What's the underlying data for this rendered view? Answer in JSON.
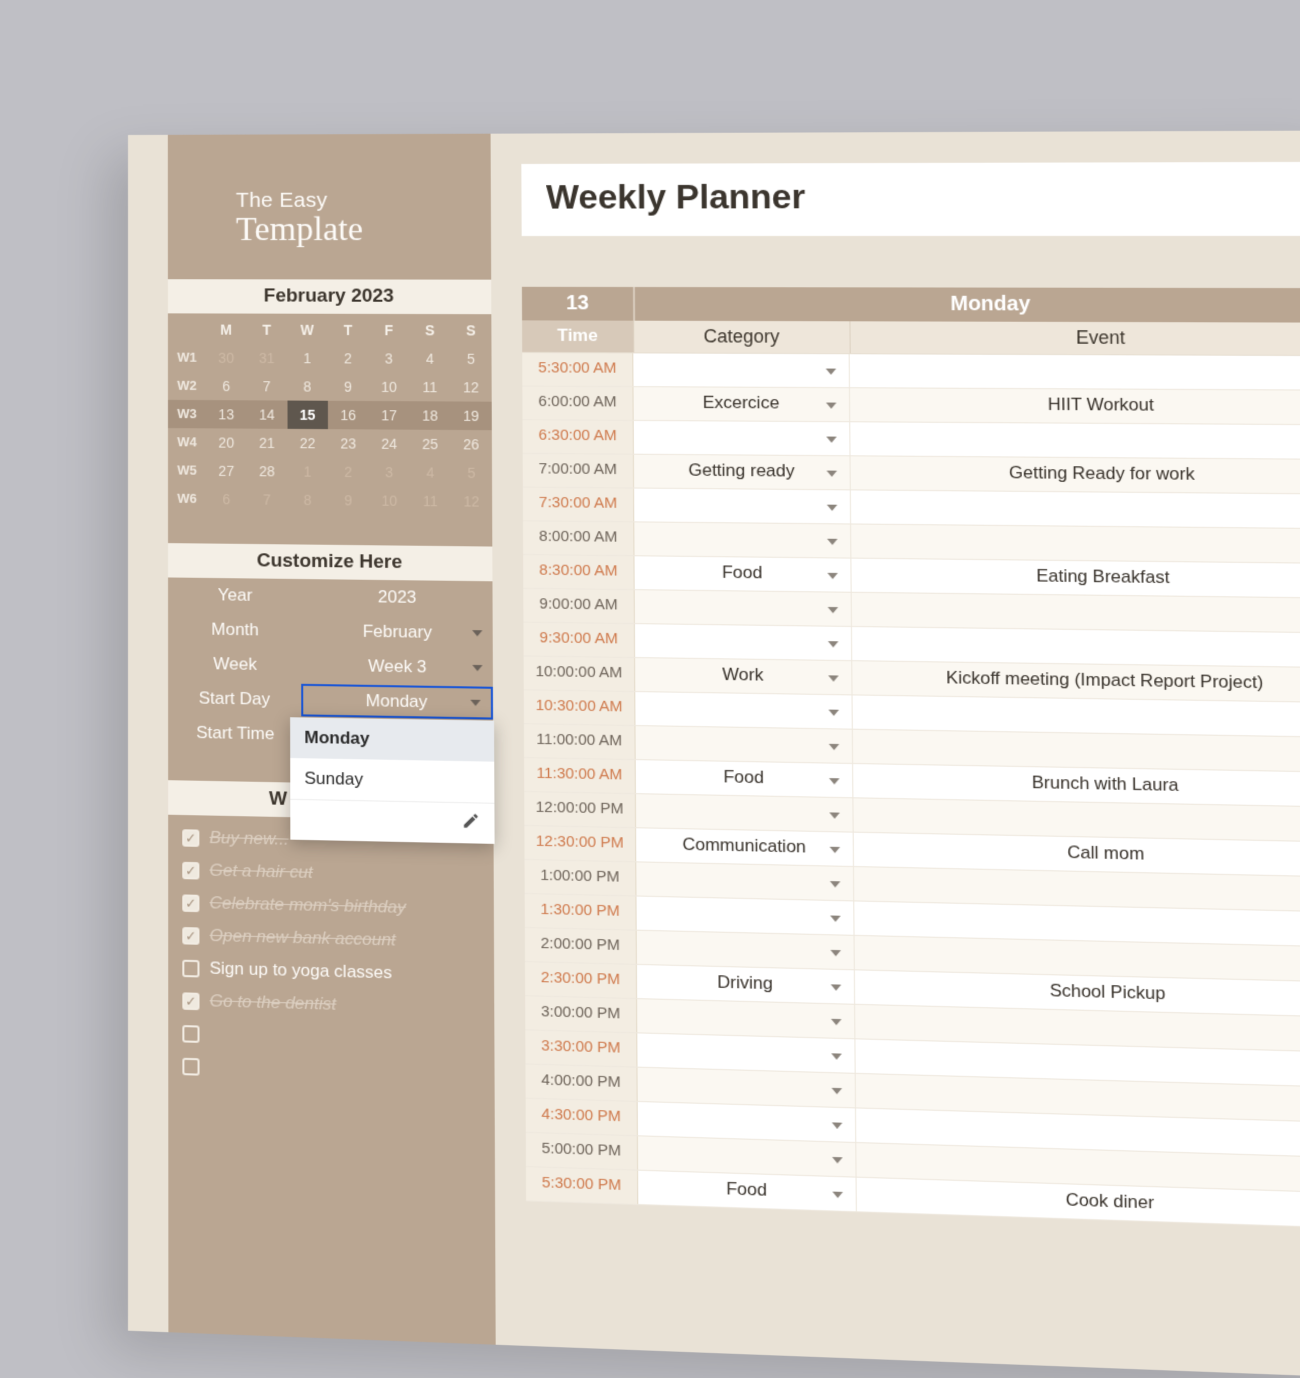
{
  "logo": {
    "line1": "The Easy",
    "line2": "Template"
  },
  "calendar": {
    "title": "February 2023",
    "day_headers": [
      "M",
      "T",
      "W",
      "T",
      "F",
      "S",
      "S"
    ],
    "weeks": [
      {
        "wk": "W1",
        "days": [
          "30",
          "31",
          "1",
          "2",
          "3",
          "4",
          "5"
        ],
        "muted": [
          0,
          1
        ]
      },
      {
        "wk": "W2",
        "days": [
          "6",
          "7",
          "8",
          "9",
          "10",
          "11",
          "12"
        ],
        "muted": []
      },
      {
        "wk": "W3",
        "days": [
          "13",
          "14",
          "15",
          "16",
          "17",
          "18",
          "19"
        ],
        "muted": [],
        "highlight": true,
        "today_idx": 2
      },
      {
        "wk": "W4",
        "days": [
          "20",
          "21",
          "22",
          "23",
          "24",
          "25",
          "26"
        ],
        "muted": []
      },
      {
        "wk": "W5",
        "days": [
          "27",
          "28",
          "1",
          "2",
          "3",
          "4",
          "5"
        ],
        "muted": [
          2,
          3,
          4,
          5,
          6
        ]
      },
      {
        "wk": "W6",
        "days": [
          "6",
          "7",
          "8",
          "9",
          "10",
          "11",
          "12"
        ],
        "muted": [
          0,
          1,
          2,
          3,
          4,
          5,
          6
        ]
      }
    ]
  },
  "customize": {
    "header": "Customize Here",
    "rows": [
      {
        "label": "Year",
        "value": "2023",
        "dropdown": false
      },
      {
        "label": "Month",
        "value": "February",
        "dropdown": true
      },
      {
        "label": "Week",
        "value": "Week 3",
        "dropdown": true
      },
      {
        "label": "Start Day",
        "value": "Monday",
        "dropdown": true,
        "selected": true
      },
      {
        "label": "Start Time",
        "value": "",
        "dropdown": false
      }
    ],
    "dropdown_options": [
      "Monday",
      "Sunday"
    ]
  },
  "goals": {
    "header": "W",
    "items": [
      {
        "text": "Buy new...",
        "done": true
      },
      {
        "text": "Get a hair cut",
        "done": true
      },
      {
        "text": "Celebrate mom's birthday",
        "done": true
      },
      {
        "text": "Open new bank account",
        "done": true
      },
      {
        "text": "Sign up to yoga classes",
        "done": false
      },
      {
        "text": "Go to the dentist",
        "done": true
      },
      {
        "text": "",
        "done": false
      },
      {
        "text": "",
        "done": false
      }
    ]
  },
  "main": {
    "title": "Weekly Planner",
    "day_number": "13",
    "day_name": "Monday",
    "col_time": "Time",
    "col_category": "Category",
    "col_event": "Event",
    "rows": [
      {
        "time": "5:30:00 AM",
        "half": true,
        "category": "",
        "event": ""
      },
      {
        "time": "6:00:00 AM",
        "half": false,
        "category": "Excercice",
        "event": "HIIT Workout"
      },
      {
        "time": "6:30:00 AM",
        "half": true,
        "category": "",
        "event": ""
      },
      {
        "time": "7:00:00 AM",
        "half": false,
        "category": "Getting ready",
        "event": "Getting Ready for work"
      },
      {
        "time": "7:30:00 AM",
        "half": true,
        "category": "",
        "event": ""
      },
      {
        "time": "8:00:00 AM",
        "half": false,
        "category": "",
        "event": ""
      },
      {
        "time": "8:30:00 AM",
        "half": true,
        "category": "Food",
        "event": "Eating Breakfast"
      },
      {
        "time": "9:00:00 AM",
        "half": false,
        "category": "",
        "event": ""
      },
      {
        "time": "9:30:00 AM",
        "half": true,
        "category": "",
        "event": ""
      },
      {
        "time": "10:00:00 AM",
        "half": false,
        "category": "Work",
        "event": "Kickoff meeting (Impact Report Project)"
      },
      {
        "time": "10:30:00 AM",
        "half": true,
        "category": "",
        "event": ""
      },
      {
        "time": "11:00:00 AM",
        "half": false,
        "category": "",
        "event": ""
      },
      {
        "time": "11:30:00 AM",
        "half": true,
        "category": "Food",
        "event": "Brunch with Laura"
      },
      {
        "time": "12:00:00 PM",
        "half": false,
        "category": "",
        "event": ""
      },
      {
        "time": "12:30:00 PM",
        "half": true,
        "category": "Communication",
        "event": "Call mom"
      },
      {
        "time": "1:00:00 PM",
        "half": false,
        "category": "",
        "event": ""
      },
      {
        "time": "1:30:00 PM",
        "half": true,
        "category": "",
        "event": ""
      },
      {
        "time": "2:00:00 PM",
        "half": false,
        "category": "",
        "event": ""
      },
      {
        "time": "2:30:00 PM",
        "half": true,
        "category": "Driving",
        "event": "School Pickup"
      },
      {
        "time": "3:00:00 PM",
        "half": false,
        "category": "",
        "event": ""
      },
      {
        "time": "3:30:00 PM",
        "half": true,
        "category": "",
        "event": ""
      },
      {
        "time": "4:00:00 PM",
        "half": false,
        "category": "",
        "event": ""
      },
      {
        "time": "4:30:00 PM",
        "half": true,
        "category": "",
        "event": ""
      },
      {
        "time": "5:00:00 PM",
        "half": false,
        "category": "",
        "event": ""
      },
      {
        "time": "5:30:00 PM",
        "half": true,
        "category": "Food",
        "event": "Cook diner"
      }
    ]
  }
}
